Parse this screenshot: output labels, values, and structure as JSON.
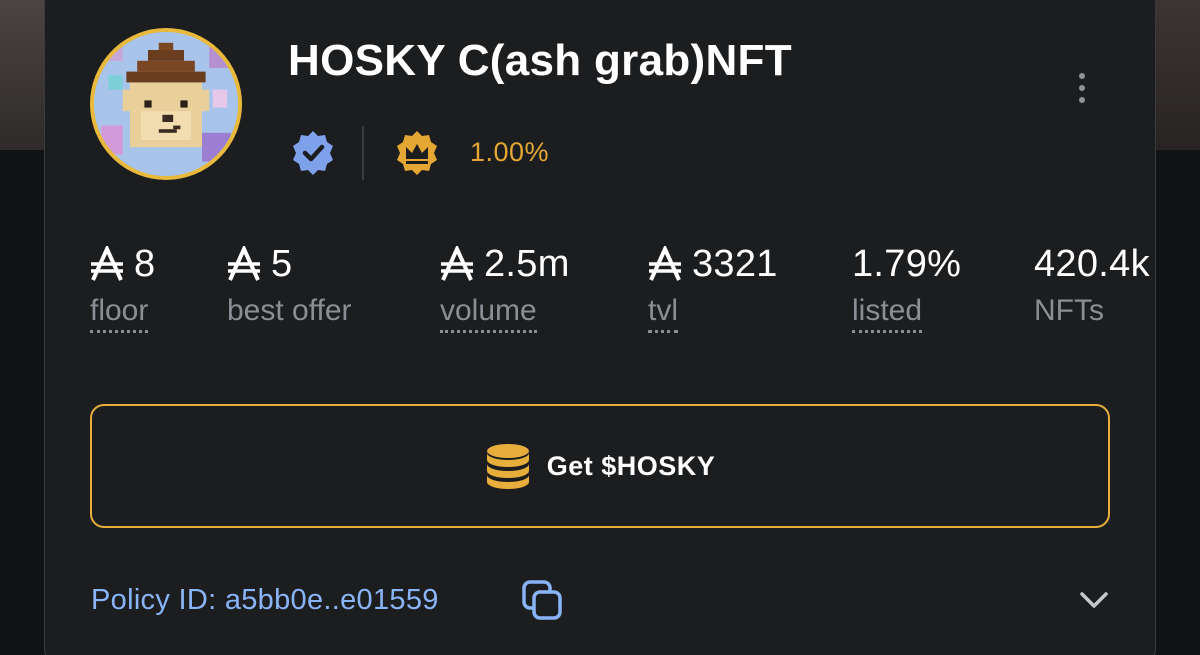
{
  "collection": {
    "title": "HOSKY C(ash grab)NFT",
    "royalty": "1.00%",
    "verified_icon": "verified-badge-icon",
    "royalty_icon": "crown-icon"
  },
  "stats": [
    {
      "value": "8",
      "currency": "ada-icon",
      "label": "floor"
    },
    {
      "value": "5",
      "currency": "ada-icon",
      "label": "best offer"
    },
    {
      "value": "2.5m",
      "currency": "ada-icon",
      "label": "volume"
    },
    {
      "value": "3321",
      "currency": "ada-icon",
      "label": "tvl"
    },
    {
      "value": "1.79%",
      "label": "listed"
    },
    {
      "value": "420.4k",
      "label": "NFTs"
    }
  ],
  "actions": {
    "get_token_label": "Get $HOSKY"
  },
  "policy": {
    "label": "Policy ID: a5bb0e..e01559"
  },
  "colors": {
    "accent_gold": "#e7ae3c",
    "link_blue": "#8ab4f8",
    "card_bg": "#1c1d1f"
  }
}
